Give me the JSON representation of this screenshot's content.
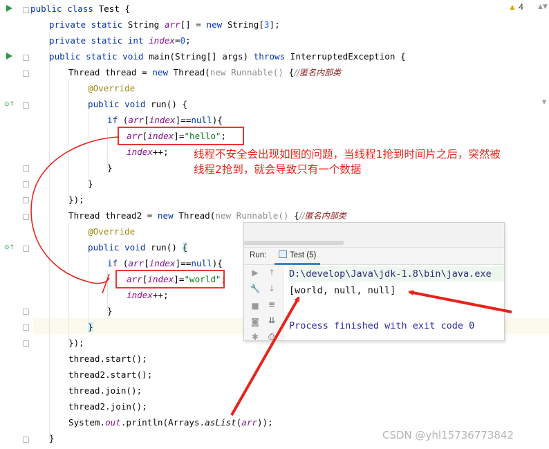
{
  "warnings": {
    "count": "4"
  },
  "code": [
    [
      "public class Test {"
    ],
    [
      "private static String arr[] = new String[3];"
    ],
    [
      "private static int index=0;"
    ],
    [
      "public static void main(String[] args) throws InterruptedException {"
    ],
    [
      "Thread thread = new Thread(new Runnable() {//匿名内部类"
    ],
    [
      "@Override"
    ],
    [
      "public void run() {"
    ],
    [
      "if (arr[index]==null){"
    ],
    [
      "arr[index]=\"hello\";"
    ],
    [
      "index++;"
    ],
    [
      "}"
    ],
    [
      "}"
    ],
    [
      "});"
    ],
    [
      "Thread thread2 = new Thread(new Runnable() {//匿名内部类"
    ],
    [
      "@Override"
    ],
    [
      "public void run() {"
    ],
    [
      "if (arr[index]==null){"
    ],
    [
      "arr[index]=\"world\";"
    ],
    [
      "index++;"
    ],
    [
      "}"
    ],
    [
      "}"
    ],
    [
      "});"
    ],
    [
      "thread.start();"
    ],
    [
      "thread2.start();"
    ],
    [
      "thread.join();"
    ],
    [
      "thread2.join();"
    ],
    [
      "System.out.println(Arrays.asList(arr));"
    ],
    [
      "}"
    ]
  ],
  "note": {
    "line1": "线程不安全会出现如图的问题，当线程1抢到时间片之后，突然被",
    "line2": "线程2抢到，就会导致只有一个数据"
  },
  "run_panel": {
    "label": "Run:",
    "tab": "Test (5)",
    "output": [
      "D:\\develop\\Java\\jdk-1.8\\bin\\java.exe",
      "[world, null, null]",
      "Process finished with exit code 0"
    ]
  },
  "watermark": "CSDN @yhl15736773842",
  "colors": {
    "annotation_red": "#e8231a",
    "keyword": "#0033b3",
    "field": "#871094",
    "string": "#067d17"
  }
}
